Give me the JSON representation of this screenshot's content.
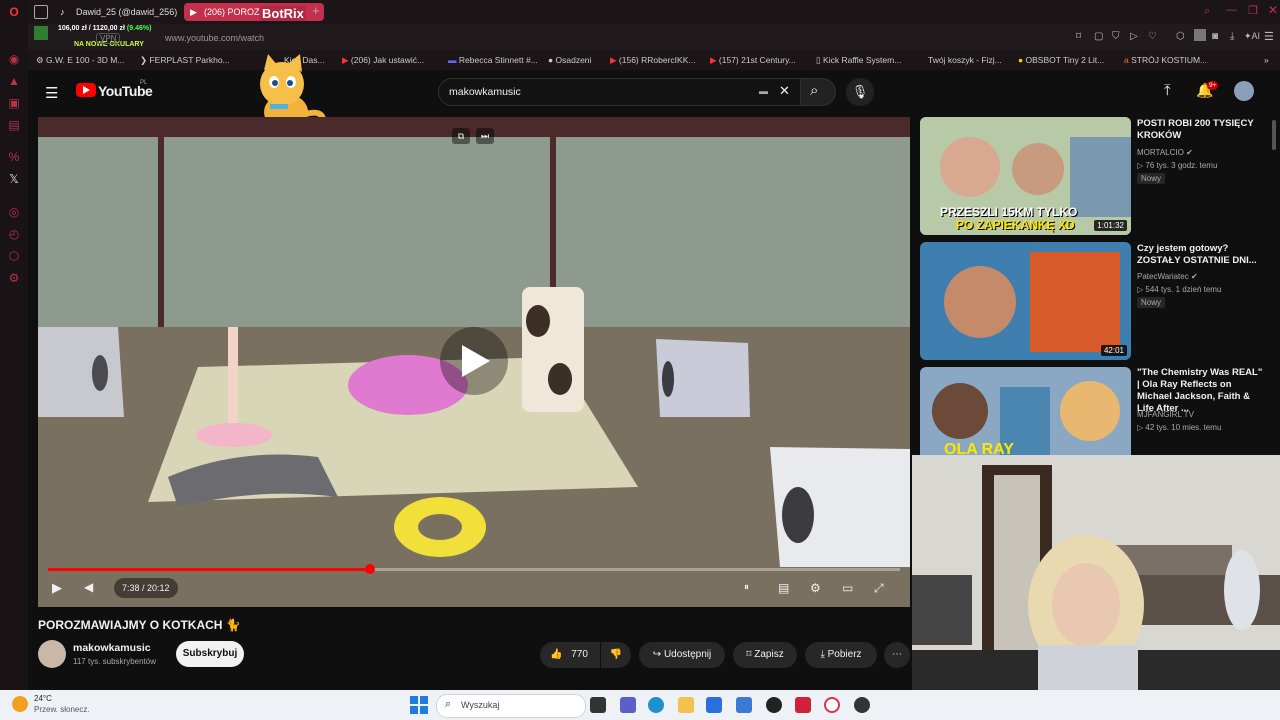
{
  "browser": {
    "tabs": [
      {
        "label": "Dawid_25 (@dawid_256)"
      },
      {
        "label": "(206) POROZM"
      }
    ],
    "overlay_bot": "BotRix",
    "address": "www.youtube.com/watch",
    "goal_text": "106,00 zł / 1120,00 zł",
    "goal_pct": "(9.46%)",
    "goal_note": "NA NOWE OKULARY",
    "bookmarks": [
      "G.W. E 100 - 3D M...",
      "FERPLAST Parkho...",
      "Kick Das...",
      "(206) Jak ustawić...",
      "Rebecca Stinnett #...",
      "Osadzeni",
      "(156) RRobercIKK...",
      "(157) 21st Century...",
      "Kick Raffle System...",
      "Twój koszyk - Fizj...",
      "OBSBOT Tiny 2 Lit...",
      "STRÓJ KOSTIUM..."
    ],
    "addr_right_label": "AI"
  },
  "youtube": {
    "logo": "YouTube",
    "region": "PL",
    "search_value": "makowkamusic",
    "notif_count": "9+",
    "video": {
      "time": "7:38 / 20:12",
      "progress": 0.378,
      "title": "POROZMAWIAJMY O KOTKACH 🐈",
      "channel": "makowkamusic",
      "subs": "117 tys. subskrybentów",
      "subscribe": "Subskrybuj",
      "likes": "770",
      "share": "Udostępnij",
      "save": "Zapisz",
      "download": "Pobierz"
    },
    "recommended": [
      {
        "title": "POSTI ROBI 200 TYSIĘCY KROKÓW",
        "channel": "MORTALCIO",
        "meta": "76 tys.   3 godz. temu",
        "badge": "Nowy",
        "duration": "1:01:32",
        "thumb_caption_1": "PRZESZLI 15KM TYLKO",
        "thumb_caption_2": "PO ZAPIEKANKĘ XD"
      },
      {
        "title": "Czy jestem gotowy? ZOSTAŁY OSTATNIE DNI...",
        "channel": "PatecWariatec",
        "meta": "544 tys.   1 dzień temu",
        "badge": "Nowy",
        "duration": "42:01"
      },
      {
        "title": "\"The Chemistry Was REAL\" | Ola Ray Reflects on Michael Jackson, Faith & Life After ...",
        "channel": "MJFANGIRL TV",
        "meta": "42 tys.   10 mies. temu",
        "thumb_caption_1": "OLA RAY"
      }
    ]
  },
  "taskbar": {
    "weather_temp": "24°C",
    "weather_desc": "Przew. słonecz.",
    "search_placeholder": "Wyszukaj"
  },
  "colors": {
    "accent": "#ff0000",
    "browser_accent": "#c4304b"
  }
}
